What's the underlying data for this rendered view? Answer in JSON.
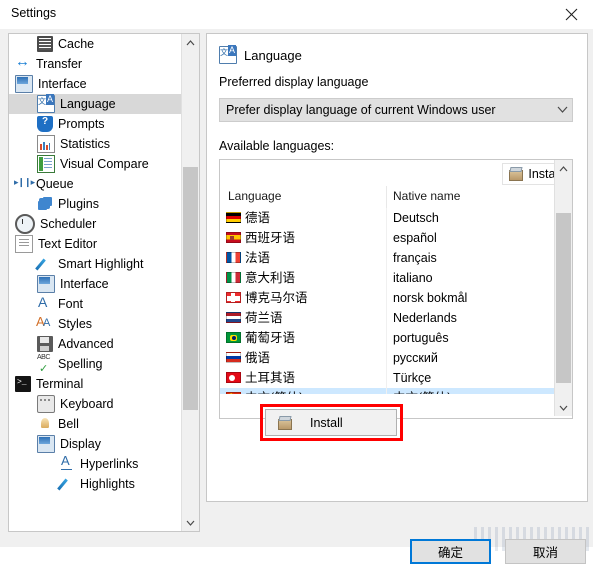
{
  "window": {
    "title": "Settings",
    "close_icon": "close-icon"
  },
  "sidebar": {
    "items": [
      {
        "label": "Cache",
        "icon": "cache-icon",
        "indent": 1,
        "selected": false
      },
      {
        "label": "Transfer",
        "icon": "transfer-icon",
        "indent": 0,
        "selected": false
      },
      {
        "label": "Interface",
        "icon": "monitor-icon",
        "indent": 0,
        "selected": false
      },
      {
        "label": "Language",
        "icon": "language-icon",
        "indent": 1,
        "selected": true
      },
      {
        "label": "Prompts",
        "icon": "shield-question-icon",
        "indent": 1,
        "selected": false
      },
      {
        "label": "Statistics",
        "icon": "statistics-icon",
        "indent": 1,
        "selected": false
      },
      {
        "label": "Visual Compare",
        "icon": "visual-compare-icon",
        "indent": 1,
        "selected": false
      },
      {
        "label": "Queue",
        "icon": "queue-icon",
        "indent": 0,
        "selected": false
      },
      {
        "label": "Plugins",
        "icon": "plugin-icon",
        "indent": 1,
        "selected": false
      },
      {
        "label": "Scheduler",
        "icon": "clock-icon",
        "indent": 0,
        "selected": false
      },
      {
        "label": "Text Editor",
        "icon": "document-icon",
        "indent": 0,
        "selected": false
      },
      {
        "label": "Smart Highlight",
        "icon": "pencil-icon",
        "indent": 1,
        "selected": false
      },
      {
        "label": "Interface",
        "icon": "monitor-icon",
        "indent": 1,
        "selected": false
      },
      {
        "label": "Font",
        "icon": "font-a-icon",
        "indent": 1,
        "selected": false
      },
      {
        "label": "Styles",
        "icon": "styles-icon",
        "indent": 1,
        "selected": false
      },
      {
        "label": "Advanced",
        "icon": "save-icon",
        "indent": 1,
        "selected": false
      },
      {
        "label": "Spelling",
        "icon": "spelling-icon",
        "indent": 1,
        "selected": false
      },
      {
        "label": "Terminal",
        "icon": "terminal-icon",
        "indent": 0,
        "selected": false
      },
      {
        "label": "Keyboard",
        "icon": "keyboard-icon",
        "indent": 1,
        "selected": false
      },
      {
        "label": "Bell",
        "icon": "bell-icon",
        "indent": 1,
        "selected": false
      },
      {
        "label": "Display",
        "icon": "monitor-icon",
        "indent": 1,
        "selected": false
      },
      {
        "label": "Hyperlinks",
        "icon": "hyperlink-icon",
        "indent": 2,
        "selected": false
      },
      {
        "label": "Highlights",
        "icon": "pencil-icon",
        "indent": 2,
        "selected": false
      }
    ],
    "scroll_up_icon": "chevron-up-icon",
    "scroll_down_icon": "chevron-down-icon"
  },
  "panel": {
    "icon": "language-icon",
    "title": "Language",
    "preferred_label": "Preferred display language",
    "combo_value": "Prefer display language of current Windows user",
    "combo_arrow_icon": "chevron-down-icon",
    "available_label": "Available languages:",
    "install_button": "Install",
    "install_icon": "package-icon",
    "columns": {
      "language": "Language",
      "native": "Native name"
    },
    "languages": [
      {
        "flag": "de",
        "name": "德语",
        "native": "Deutsch",
        "selected": false
      },
      {
        "flag": "es",
        "name": "西班牙语",
        "native": "español",
        "selected": false
      },
      {
        "flag": "fr",
        "name": "法语",
        "native": "français",
        "selected": false
      },
      {
        "flag": "it",
        "name": "意大利语",
        "native": "italiano",
        "selected": false
      },
      {
        "flag": "no",
        "name": "博克马尔语",
        "native": "norsk bokmål",
        "selected": false
      },
      {
        "flag": "nl",
        "name": "荷兰语",
        "native": "Nederlands",
        "selected": false
      },
      {
        "flag": "br",
        "name": "葡萄牙语",
        "native": "português",
        "selected": false
      },
      {
        "flag": "ru",
        "name": "俄语",
        "native": "русский",
        "selected": false
      },
      {
        "flag": "tr",
        "name": "土耳其语",
        "native": "Türkçe",
        "selected": false
      },
      {
        "flag": "cn",
        "name": "中文(简体)",
        "native": "中文(简体)",
        "selected": true
      }
    ],
    "list_scroll_up_icon": "chevron-up-icon",
    "list_scroll_down_icon": "chevron-down-icon"
  },
  "context_menu": {
    "install_label": "Install",
    "install_icon": "package-icon",
    "highlight_color": "#ff0000"
  },
  "footer": {
    "ok_label": "确定",
    "cancel_label": "取消",
    "accent_color": "#0078d7"
  }
}
